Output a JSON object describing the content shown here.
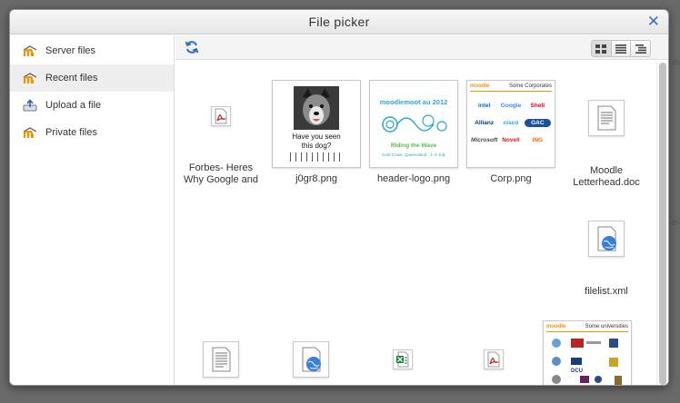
{
  "dialog": {
    "title": "File picker"
  },
  "sidebar": {
    "items": [
      {
        "label": "Server files",
        "icon": "moodle-icon"
      },
      {
        "label": "Recent files",
        "icon": "moodle-icon",
        "active": true
      },
      {
        "label": "Upload a file",
        "icon": "upload-icon"
      },
      {
        "label": "Private files",
        "icon": "moodle-icon"
      }
    ]
  },
  "files": [
    {
      "name_line1": "Forbes- Heres",
      "name_line2": "Why Google and",
      "icon": "pdf-icon"
    },
    {
      "name_line1": "j0gr8.png",
      "name_line2": "",
      "icon": "image-thumbnail",
      "caption_line1": "Have you seen",
      "caption_line2": "this dog?"
    },
    {
      "name_line1": "header-logo.png",
      "name_line2": "",
      "icon": "image-thumbnail",
      "logo_text": "moodlemoot au 2012",
      "logo_sub": "Riding the Wave",
      "logo_sub2": "Gold Coast, Queensland · 1–4 July"
    },
    {
      "name_line1": "Corp.png",
      "name_line2": "",
      "icon": "image-thumbnail",
      "brand": "moodle",
      "tagline": "Some Corporates",
      "logos": [
        "intel",
        "Google",
        "Shell",
        "Allianz",
        "cisco",
        "GAC",
        "Microsoft",
        "Novell",
        "ING"
      ]
    },
    {
      "name_line1": "Moodle",
      "name_line2": "Letterhead.doc",
      "icon": "document-icon"
    },
    {
      "name_line1": "filelist.xml",
      "name_line2": "",
      "icon": "xml-globe-icon"
    },
    {
      "name_line1": "",
      "name_line2": "",
      "icon": "document-icon"
    },
    {
      "name_line1": "",
      "name_line2": "",
      "icon": "xml-globe-icon"
    },
    {
      "name_line1": "",
      "name_line2": "",
      "icon": "spreadsheet-icon"
    },
    {
      "name_line1": "",
      "name_line2": "",
      "icon": "pdf-icon"
    },
    {
      "name_line1": "",
      "name_line2": "",
      "icon": "image-thumbnail",
      "brand": "moodle",
      "tagline": "Some universities",
      "logos": [
        "DCU"
      ]
    }
  ],
  "colors": {
    "accent": "#3a72c6",
    "moodle_orange": "#f39200",
    "pdf_red": "#c8201e",
    "excel_green": "#1d7a3a"
  }
}
